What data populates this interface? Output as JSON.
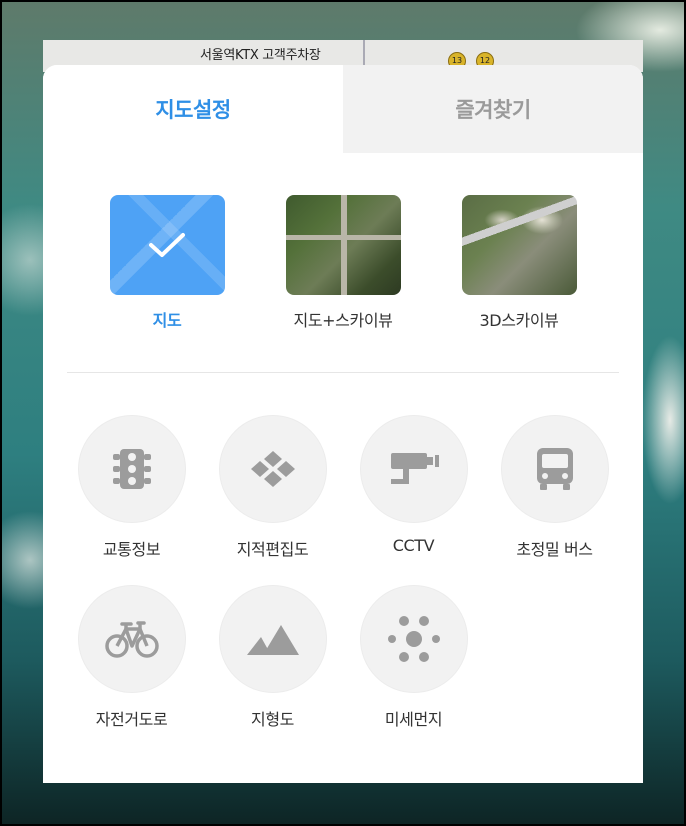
{
  "map": {
    "label": "서울역KTX 고객주차장",
    "badges": [
      "13",
      "12"
    ]
  },
  "tabs": [
    {
      "label": "지도설정",
      "active": true
    },
    {
      "label": "즐겨찾기",
      "active": false
    }
  ],
  "map_types": [
    {
      "label": "지도",
      "icon": "check-icon",
      "selected": true
    },
    {
      "label": "지도+스카이뷰",
      "selected": false
    },
    {
      "label": "3D스카이뷰",
      "selected": false
    }
  ],
  "layers": [
    {
      "label": "교통정보",
      "icon": "traffic-light-icon"
    },
    {
      "label": "지적편집도",
      "icon": "cadastral-diamond-icon"
    },
    {
      "label": "CCTV",
      "icon": "cctv-camera-icon"
    },
    {
      "label": "초정밀 버스",
      "icon": "bus-icon"
    },
    {
      "label": "자전거도로",
      "icon": "bicycle-icon"
    },
    {
      "label": "지형도",
      "icon": "mountain-icon"
    },
    {
      "label": "미세먼지",
      "icon": "dust-dots-icon"
    }
  ],
  "colors": {
    "accent": "#2f8fe6",
    "selected_thumb": "#4ea2f5",
    "icon_gray": "#9c9c9c",
    "circle_bg": "#f2f2f2"
  }
}
